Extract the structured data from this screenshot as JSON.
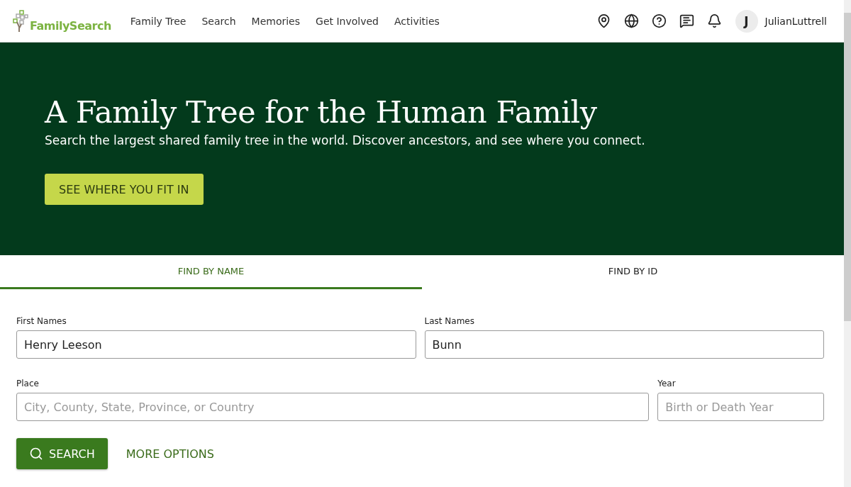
{
  "header": {
    "logo_text": "FamilySearch",
    "nav": [
      "Family Tree",
      "Search",
      "Memories",
      "Get Involved",
      "Activities"
    ],
    "user": {
      "initial": "J",
      "name": "JulianLuttrell"
    }
  },
  "hero": {
    "title": "A Family Tree for the Human Family",
    "subtitle": "Search the largest shared family tree in the world. Discover ancestors, and see where you connect.",
    "button": "SEE WHERE YOU FIT IN"
  },
  "tabs": [
    {
      "label": "FIND BY NAME",
      "selected": true
    },
    {
      "label": "FIND BY ID",
      "selected": false
    }
  ],
  "form": {
    "rows": [
      [
        {
          "label": "First Names",
          "value": "Henry Leeson"
        },
        {
          "label": "Last Names",
          "value": "Bunn"
        }
      ],
      [
        {
          "label": "Place",
          "placeholder": "City, County, State, Province, or Country"
        },
        {
          "label": "Year",
          "placeholder": "Birth or Death Year"
        }
      ]
    ],
    "search_button": "SEARCH",
    "more_options": "MORE OPTIONS"
  }
}
